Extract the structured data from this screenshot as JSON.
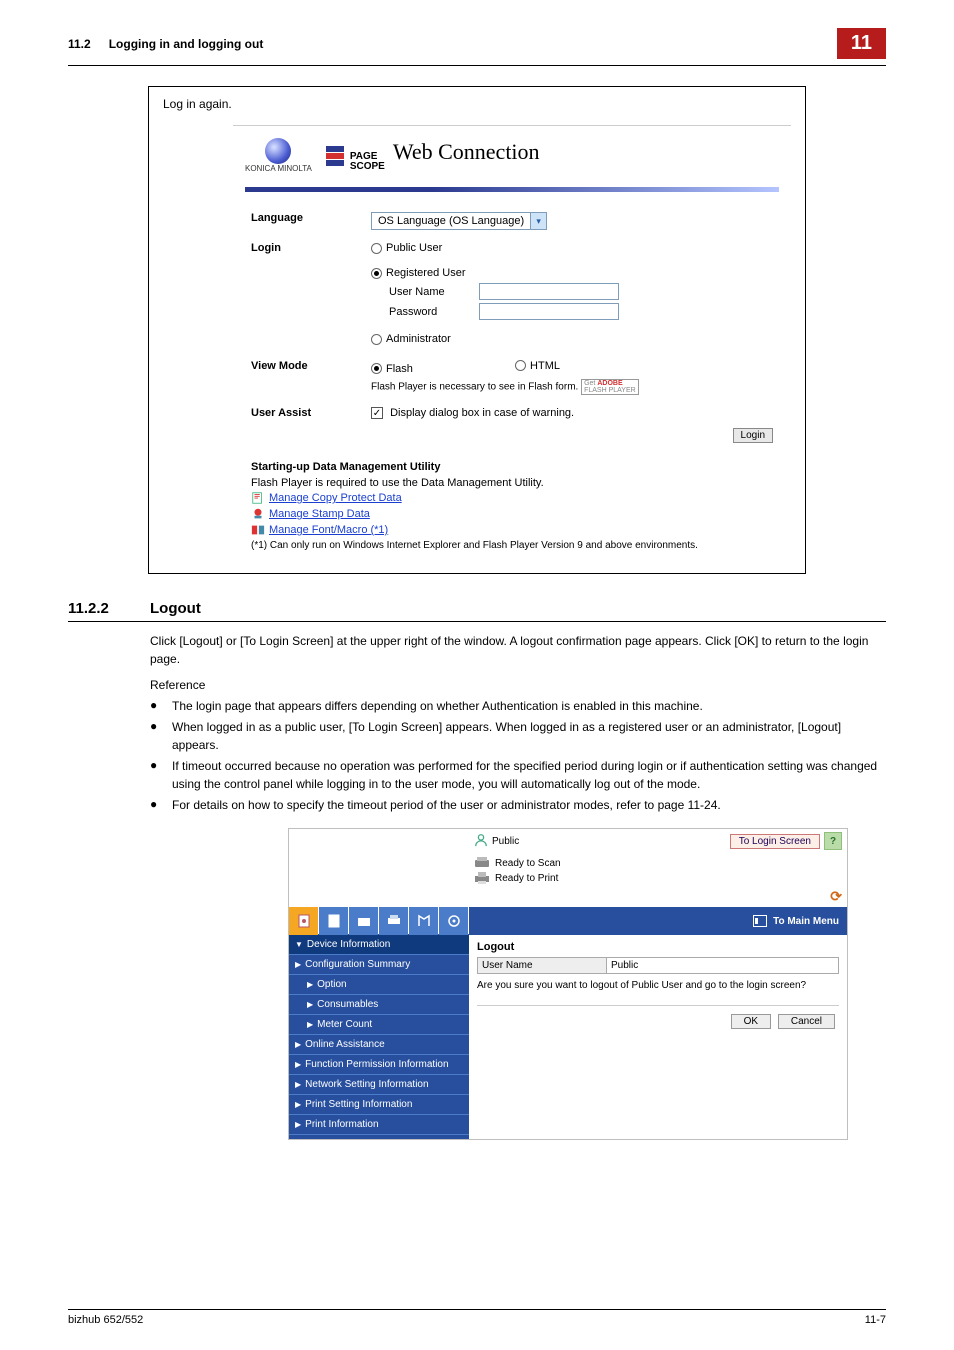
{
  "header": {
    "section_num": "11.2",
    "section_title": "Logging in and logging out",
    "chapter_badge": "11"
  },
  "box1": {
    "lead": "Log in again.",
    "brand_km": "KONICA MINOLTA",
    "brand_page": "PAGE",
    "brand_scope": "SCOPE",
    "brand_wc": "Web Connection",
    "rows": {
      "language_label": "Language",
      "language_value": "OS Language (OS Language)",
      "login_label": "Login",
      "login_public": "Public User",
      "login_registered": "Registered User",
      "login_username_label": "User Name",
      "login_password_label": "Password",
      "login_admin": "Administrator",
      "viewmode_label": "View Mode",
      "viewmode_flash": "Flash",
      "viewmode_html": "HTML",
      "viewmode_note": "Flash Player is necessary to see in Flash form.",
      "flash_badge_get": "Get",
      "flash_badge_adobe": "ADOBE",
      "flash_badge_fp": "FLASH PLAYER",
      "userassist_label": "User Assist",
      "userassist_check": "Display dialog box in case of warning.",
      "login_btn": "Login"
    },
    "dmu": {
      "heading": "Starting-up Data Management Utility",
      "note": "Flash Player is required to use the Data Management Utility.",
      "link1": "Manage Copy Protect Data",
      "link2": "Manage Stamp Data",
      "link3": "Manage Font/Macro (*1)",
      "foot": "(*1) Can only run on Windows Internet Explorer and Flash Player Version 9 and above environments."
    }
  },
  "sect": {
    "num": "11.2.2",
    "title": "Logout",
    "para": "Click [Logout] or [To Login Screen] at the upper right of the window. A logout confirmation page appears. Click [OK] to return to the login page.",
    "reference_label": "Reference",
    "bullets": [
      "The login page that appears differs depending on whether Authentication is enabled in this machine.",
      "When logged in as a public user, [To Login Screen] appears. When logged in as a registered user or an administrator, [Logout] appears.",
      "If timeout occurred because no operation was performed for the specified period during login or if authentication setting was changed using the control panel while logging in to the user mode, you will automatically log out of the mode.",
      "For details on how to specify the timeout period of the user or administrator modes, refer to page 11-24."
    ]
  },
  "wc": {
    "user_label": "Public",
    "to_login": "To Login Screen",
    "status_scan": "Ready to Scan",
    "status_print": "Ready to Print",
    "main_menu": "To Main Menu",
    "side": {
      "device_info": "Device Information",
      "config_summary": "Configuration Summary",
      "option": "Option",
      "consumables": "Consumables",
      "meter_count": "Meter Count",
      "online_assist": "Online Assistance",
      "func_perm": "Function Permission Information",
      "net_setting": "Network Setting Information",
      "print_setting": "Print Setting Information",
      "print_info": "Print Information"
    },
    "content": {
      "heading": "Logout",
      "col_user": "User Name",
      "val_user": "Public",
      "question": "Are you sure you want to logout of Public User and go to the login screen?",
      "ok": "OK",
      "cancel": "Cancel"
    }
  },
  "footer": {
    "left": "bizhub 652/552",
    "right": "11-7"
  }
}
